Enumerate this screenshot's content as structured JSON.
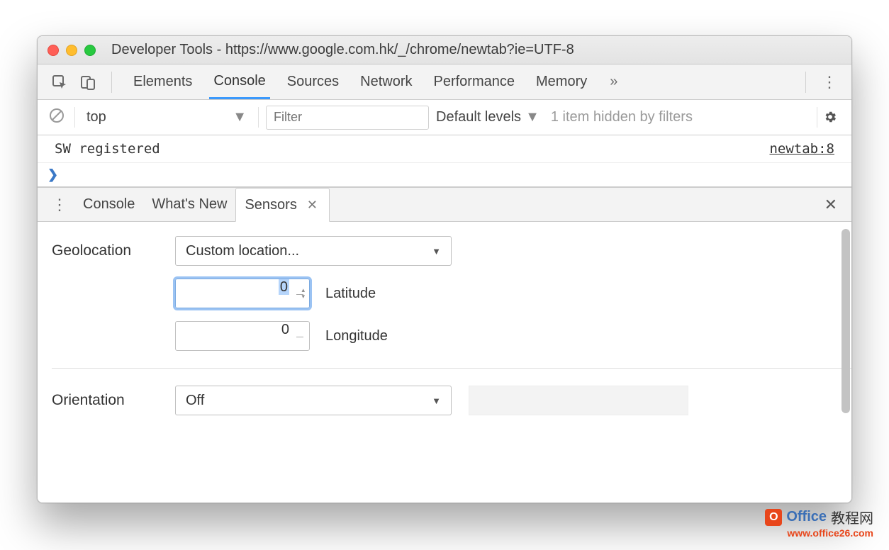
{
  "window": {
    "title": "Developer Tools - https://www.google.com.hk/_/chrome/newtab?ie=UTF-8"
  },
  "mainTabs": {
    "items": [
      "Elements",
      "Console",
      "Sources",
      "Network",
      "Performance",
      "Memory"
    ],
    "active": "Console",
    "overflow": "»"
  },
  "consoleBar": {
    "context": "top",
    "filterPlaceholder": "Filter",
    "levels": "Default levels",
    "hidden": "1 item hidden by filters"
  },
  "consoleLog": {
    "message": "SW registered",
    "source": "newtab:8"
  },
  "drawer": {
    "tabs": [
      "Console",
      "What's New",
      "Sensors"
    ],
    "active": "Sensors"
  },
  "sensors": {
    "geolocationLabel": "Geolocation",
    "geolocationSelect": "Custom location...",
    "latitudeValue": "0",
    "latitudeLabel": "Latitude",
    "longitudeValue": "0",
    "longitudeLabel": "Longitude",
    "orientationLabel": "Orientation",
    "orientationSelect": "Off"
  },
  "watermark": {
    "brand": "Office",
    "brandCn": "教程网",
    "url": "www.office26.com"
  }
}
